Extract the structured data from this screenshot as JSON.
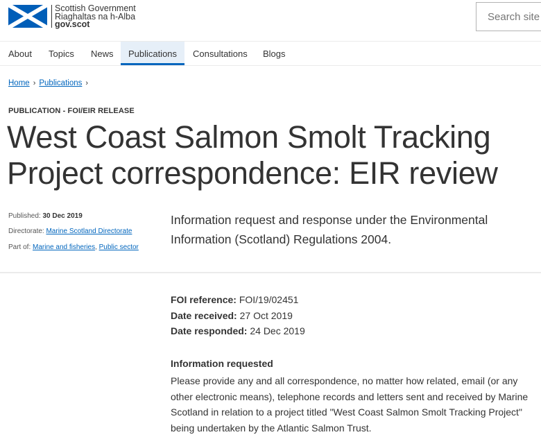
{
  "header": {
    "logo_line1": "Scottish Government",
    "logo_line2": "Riaghaltas na h-Alba",
    "logo_line3": "gov.scot",
    "search_placeholder": "Search site",
    "flag_colors": {
      "blue": "#005eb8",
      "white": "#ffffff"
    }
  },
  "nav": {
    "items": [
      {
        "label": "About"
      },
      {
        "label": "Topics"
      },
      {
        "label": "News"
      },
      {
        "label": "Publications",
        "active": true
      },
      {
        "label": "Consultations"
      },
      {
        "label": "Blogs"
      }
    ]
  },
  "breadcrumb": {
    "items": [
      {
        "label": "Home"
      },
      {
        "label": "Publications"
      }
    ],
    "separator": "›"
  },
  "publication": {
    "label": "PUBLICATION - FOI/EIR RELEASE",
    "title_line1": "West Coast Salmon Smolt Tracking",
    "title_line2": "Project correspondence: EIR review",
    "published_label": "Published:",
    "published_value": "30 Dec 2019",
    "directorate_label": "Directorate:",
    "directorate_value": "Marine Scotland Directorate",
    "part_of_label": "Part of:",
    "part_of_1": "Marine and fisheries",
    "part_of_sep": ",",
    "part_of_2": "Public sector",
    "summary": "Information request and response under the Environmental Information (Scotland) Regulations 2004."
  },
  "facts": {
    "foi_label": "FOI reference:",
    "foi_value": "FOI/19/02451",
    "received_label": "Date received:",
    "received_value": "27 Oct 2019",
    "responded_label": "Date responded:",
    "responded_value": "24 Dec 2019"
  },
  "request": {
    "heading": "Information requested",
    "body": "Please provide any and all correspondence, no matter how related, email (or any other electronic means), telephone records and letters sent and received by Marine Scotland in relation to a project titled \"West Coast Salmon Smolt Tracking Project\" being undertaken by the Atlantic Salmon Trust."
  },
  "colors": {
    "link": "#0065bd",
    "text": "#333333",
    "nav_active_bg": "#e6eff8"
  }
}
